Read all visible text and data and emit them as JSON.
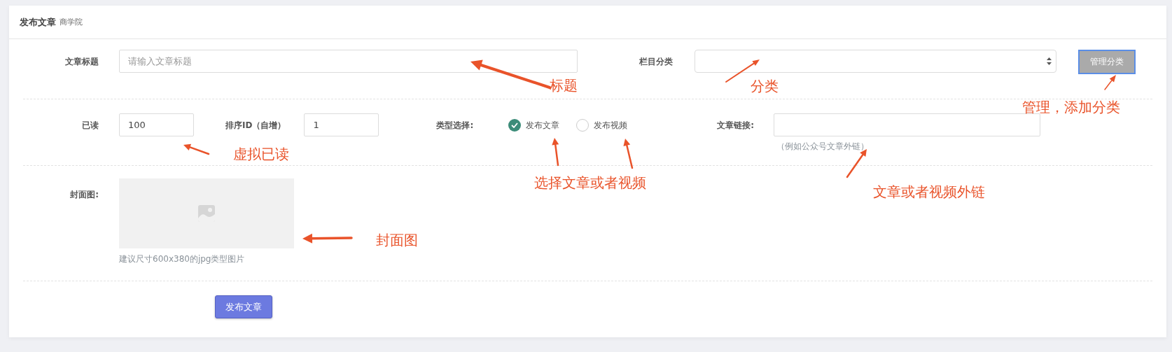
{
  "header": {
    "title": "发布文章",
    "subtitle": "商学院"
  },
  "form": {
    "title_field": {
      "label": "文章标题",
      "placeholder": "请输入文章标题"
    },
    "category": {
      "label": "栏目分类"
    },
    "manage_button": {
      "label": "管理分类"
    },
    "read": {
      "label": "已读",
      "value": "100"
    },
    "sort": {
      "label": "排序ID（自增）",
      "value": "1"
    },
    "type": {
      "label": "类型选择:",
      "options": [
        {
          "label": "发布文章",
          "selected": true
        },
        {
          "label": "发布视频",
          "selected": false
        }
      ]
    },
    "link": {
      "label": "文章链接:",
      "hint": "（例如公众号文章外链）"
    },
    "cover": {
      "label": "封面图:",
      "hint": "建议尺寸600x380的jpg类型图片"
    },
    "submit": {
      "label": "发布文章"
    }
  },
  "annotations": [
    {
      "text": "标题"
    },
    {
      "text": "分类"
    },
    {
      "text": "管理，添加分类"
    },
    {
      "text": "虚拟已读"
    },
    {
      "text": "选择文章或者视频"
    },
    {
      "text": "文章或者视频外链"
    },
    {
      "text": "封面图"
    }
  ]
}
